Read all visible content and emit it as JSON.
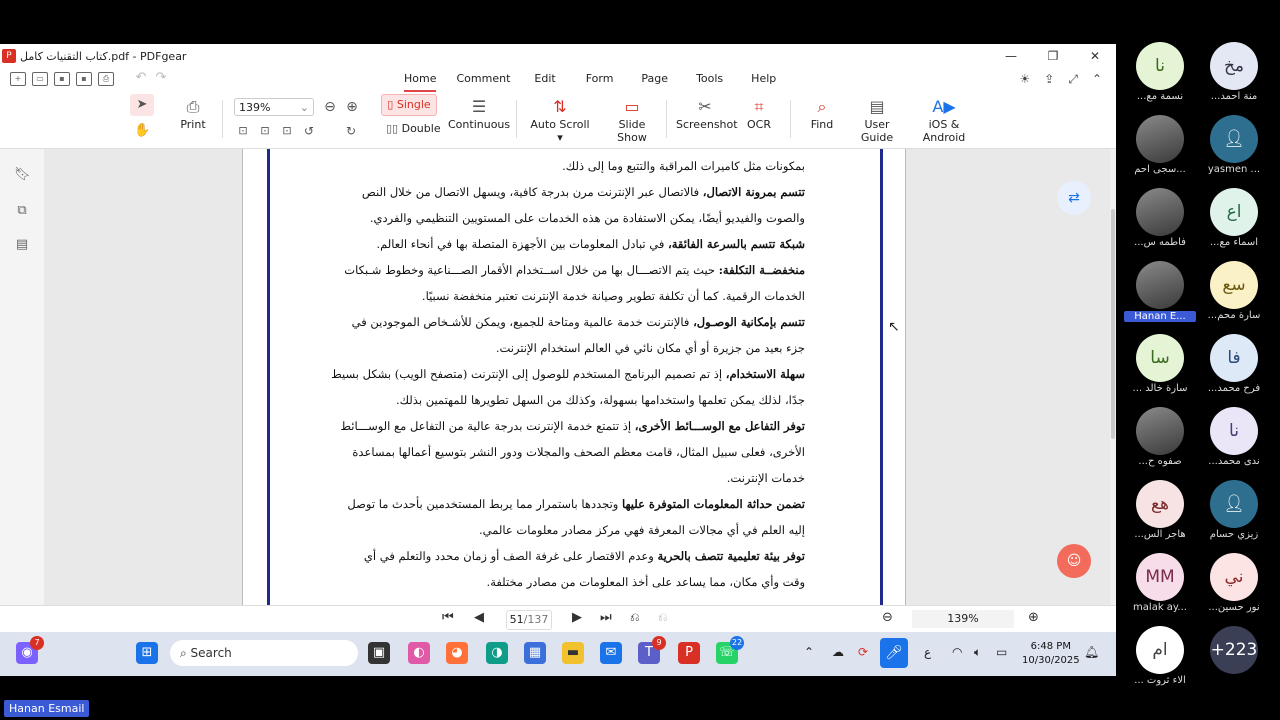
{
  "window": {
    "title": "كتاب التقنيات كامل.pdf - PDFgear"
  },
  "menu": {
    "tabs": [
      "Home",
      "Comment",
      "Edit",
      "Form",
      "Page",
      "Tools",
      "Help"
    ],
    "active": "Home"
  },
  "toolbar": {
    "print": "Print",
    "zoom": "139%",
    "single": "Single",
    "double": "Double",
    "continuous": "Continuous",
    "auto_scroll": "Auto Scroll",
    "slide_show": "Slide Show",
    "screenshot": "Screenshot",
    "ocr": "OCR",
    "find": "Find",
    "user_guide": "User Guide",
    "ios_android": "iOS & Android"
  },
  "document": {
    "lines": [
      {
        "bold": "",
        "text": "بمكونات مثل كاميرات المراقبة والتتبع وما إلى ذلك."
      },
      {
        "bullet": true,
        "bold": "تتسم بمرونة الاتصال،",
        "text": " فالاتصال عبر الإنترنت مرن بدرجة كافية، ويسهل الاتصال من خلال النص"
      },
      {
        "bold": "",
        "text": "والصوت والفيديو أيضًا، يمكن الاستفادة من هذه الخدمات على المستويين التنظيمي والفردي."
      },
      {
        "bullet": true,
        "bold": "شبكة تتسم بالسرعة الفائقة،",
        "text": " في تبادل المعلومات بين الأجهزة المتصلة بها في أنحاء العالم."
      },
      {
        "bullet": true,
        "bold": "منخفضــة التكلفة:",
        "text": " حيث يتم الاتصـــال بها من خلال اســتخدام الأقمار الصـــناعية وخطوط شـبكات"
      },
      {
        "bold": "",
        "text": "الخدمات الرقمية. كما أن تكلفة تطوير وصيانة خدمة الإنترنت تعتبر منخفضة نسبيًا."
      },
      {
        "bullet": true,
        "bold": "تتسم بإمكانية الوصـول،",
        "text": " فالإنترنت خدمة عالمية ومتاحة للجميع، ويمكن للأشـخاص الموجودين في"
      },
      {
        "bold": "",
        "text": "جزء بعيد من جزيرة أو أي مكان نائي في العالم  استخدام الإنترنت."
      },
      {
        "bullet": true,
        "bold": "سهلة الاستخدام،",
        "text": " إذ تم تصميم البرنامج المستخدم للوصول إلى الإنترنت (متصفح الويب) بشكل بسيط"
      },
      {
        "bold": "",
        "text": "جدًا، لذلك يمكن تعلمها واستخدامها بسهولة، وكذلك من السهل تطويرها للمهتمين بذلك."
      },
      {
        "bullet": true,
        "bold": "توفر التفاعل مع الوســـائط الأخرى،",
        "text": " إذ تتمتع خدمة الإنترنت بدرجة عالية من التفاعل مع الوســـائط"
      },
      {
        "bold": "",
        "text": "الأخرى، فعلى سبيل المثال، قامت معظم الصحف والمجلات ودور النشر بتوسيع أعمالها بمساعدة"
      },
      {
        "bold": "",
        "text": "خدمات الإنترنت."
      },
      {
        "bullet": true,
        "bold": "تضمن حداثة المعلومات المتوفرة عليها",
        "text": " وتجددها باستمرار مما يربط المستخدمين بأحدث ما توصل"
      },
      {
        "bold": "",
        "text": "إليه العلم في أي مجالات المعرفة فهي مركز مصادر معلومات عالمي."
      },
      {
        "bullet": true,
        "bold": "توفر بيئة تعليمية تتصف بالحرية",
        "text": " وعدم الاقتصار على غرفة الصف أو زمان محدد والتعلم في أي"
      },
      {
        "bold": "",
        "text": "وقت وأي مكان، مما يساعد على أخذ المعلومات من مصادر مختلفة."
      }
    ]
  },
  "pagenav": {
    "current": "51",
    "total": "/137",
    "zoom": "139%"
  },
  "taskbar": {
    "search": "Search",
    "time": "6:48 PM",
    "date": "10/30/2025",
    "lang": "ع",
    "badges": {
      "copilot": "7",
      "teams": "9",
      "whatsapp": "22"
    }
  },
  "participants": [
    {
      "initials": "نا",
      "name": "...نسمة مع",
      "color": "#e6f4d6",
      "fg": "#3a6b1f"
    },
    {
      "initials": "مخ",
      "name": "...منة احمد",
      "color": "#e3e8f4",
      "fg": "#334"
    },
    {
      "initials": "",
      "name": "سجى احم...",
      "photo": true
    },
    {
      "initials": "",
      "name": "yasmen ...",
      "color": "#2e6f8f",
      "fg": "#fff",
      "icon": true
    },
    {
      "initials": "",
      "name": "...فاطمه س",
      "photo": true
    },
    {
      "initials": "اع",
      "name": "...اسماء مع",
      "color": "#dff3ea",
      "fg": "#2a6b4b"
    },
    {
      "initials": "",
      "name": "Hanan E...",
      "photo": true,
      "highlight": true
    },
    {
      "initials": "سع",
      "name": "...سارة محم",
      "color": "#fbf1c7",
      "fg": "#6b5a10"
    },
    {
      "initials": "سا",
      "name": "... سارة خالد",
      "color": "#e6f4d6",
      "fg": "#3a6b1f"
    },
    {
      "initials": "فا",
      "name": "...فرح محمد",
      "color": "#dde9f7",
      "fg": "#2a4b7a"
    },
    {
      "initials": "",
      "name": "...صفوه ح",
      "photo": true
    },
    {
      "initials": "نا",
      "name": "...ندى محمد",
      "color": "#ebe6f7",
      "fg": "#4a3a7a"
    },
    {
      "initials": "هع",
      "name": "...هاجر الس",
      "color": "#f7e3e3",
      "fg": "#7a2a2a"
    },
    {
      "initials": "",
      "name": "زيزي حسام",
      "color": "#2e6f8f",
      "fg": "#fff",
      "icon": true
    },
    {
      "initials": "MM",
      "name": "malak ay...",
      "color": "#f7dde9",
      "fg": "#7a2a4b"
    },
    {
      "initials": "ني",
      "name": "...نور حسين",
      "color": "#fde4e4",
      "fg": "#8a2a2a"
    },
    {
      "initials": "ام",
      "name": "... الاء ثروت",
      "color": "#fff",
      "fg": "#444"
    },
    {
      "initials": "+223",
      "name": "",
      "color": "#3a3f55",
      "fg": "#fff"
    }
  ],
  "speaker": "Hanan Esmail"
}
